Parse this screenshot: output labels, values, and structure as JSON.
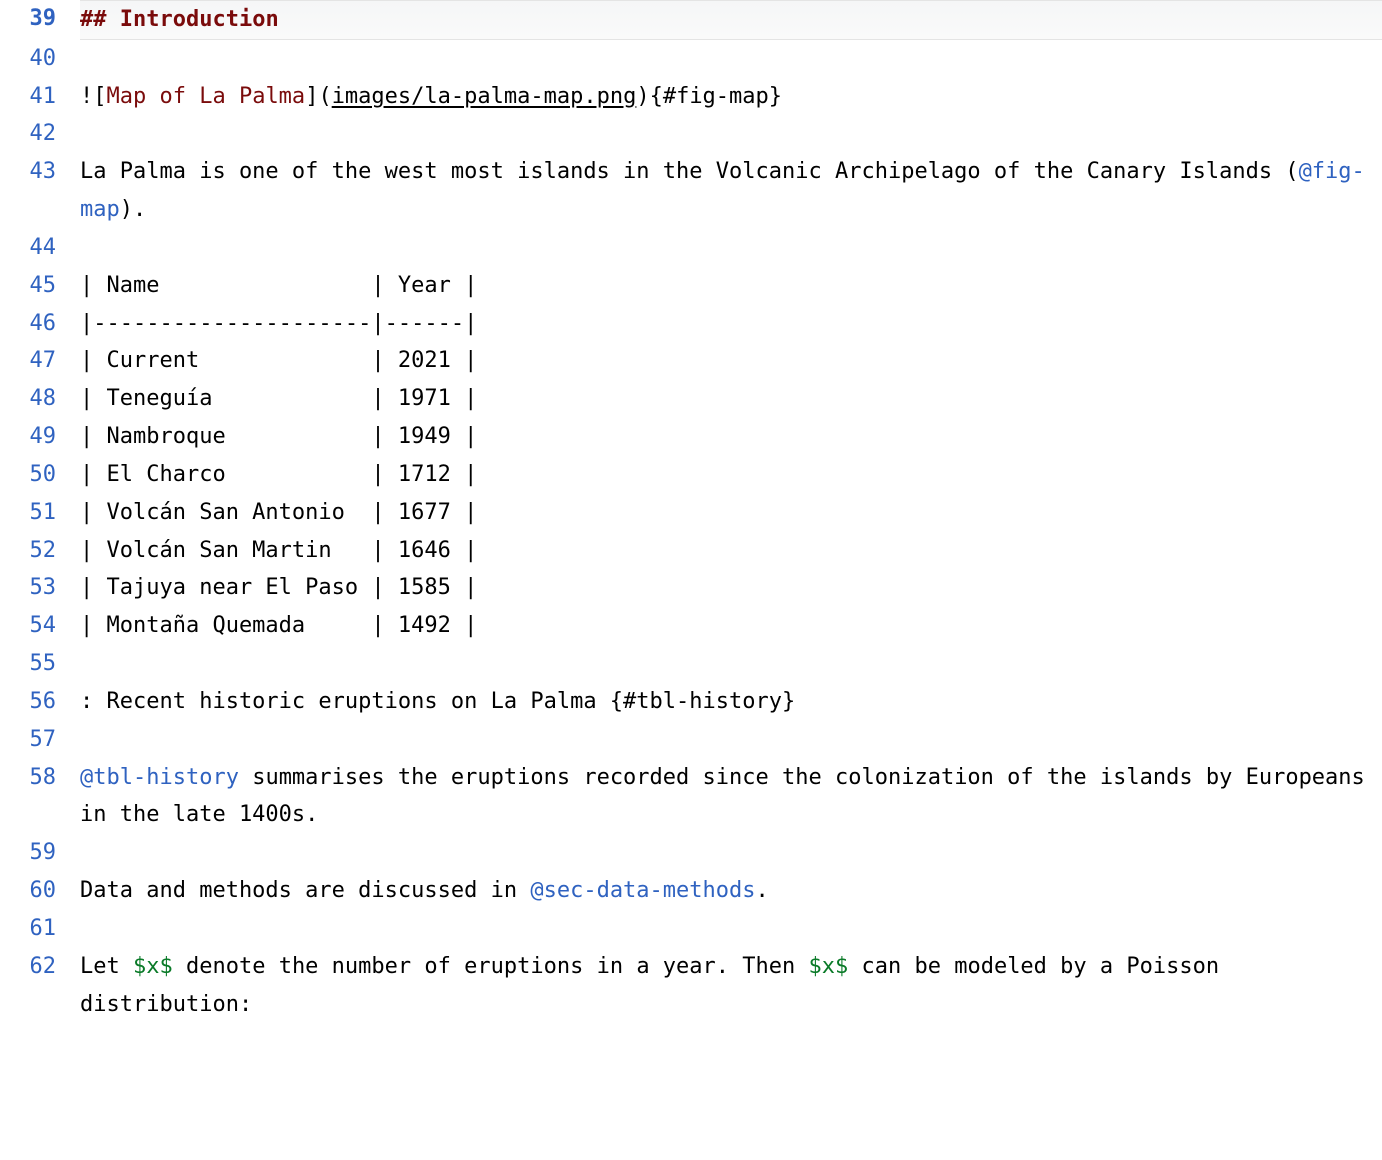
{
  "lines": [
    {
      "n": 39,
      "current": true,
      "segments": [
        {
          "cls": "hd-hash",
          "text": "## "
        },
        {
          "cls": "hd",
          "text": "Introduction"
        }
      ]
    },
    {
      "n": 40,
      "segments": []
    },
    {
      "n": 41,
      "segments": [
        {
          "cls": "plain",
          "text": "!"
        },
        {
          "cls": "bracket",
          "text": "["
        },
        {
          "cls": "alt",
          "text": "Map of La Palma"
        },
        {
          "cls": "bracket",
          "text": "]"
        },
        {
          "cls": "plain",
          "text": "("
        },
        {
          "cls": "link",
          "text": "images/la-palma-map.png"
        },
        {
          "cls": "plain",
          "text": ")"
        },
        {
          "cls": "meta",
          "text": "{#fig-map}"
        }
      ]
    },
    {
      "n": 42,
      "segments": []
    },
    {
      "n": 43,
      "segments": [
        {
          "cls": "plain",
          "text": "La Palma is one of the west most islands in the Volcanic Archipelago of the Canary Islands ("
        },
        {
          "cls": "ref",
          "text": "@fig-map"
        },
        {
          "cls": "plain",
          "text": ")."
        }
      ]
    },
    {
      "n": 44,
      "segments": []
    },
    {
      "n": 45,
      "segments": [
        {
          "cls": "plain",
          "text": "| Name                | Year |"
        }
      ]
    },
    {
      "n": 46,
      "segments": [
        {
          "cls": "plain",
          "text": "|---------------------|------|"
        }
      ]
    },
    {
      "n": 47,
      "segments": [
        {
          "cls": "plain",
          "text": "| Current             | 2021 |"
        }
      ]
    },
    {
      "n": 48,
      "segments": [
        {
          "cls": "plain",
          "text": "| Teneguía            | 1971 |"
        }
      ]
    },
    {
      "n": 49,
      "segments": [
        {
          "cls": "plain",
          "text": "| Nambroque           | 1949 |"
        }
      ]
    },
    {
      "n": 50,
      "segments": [
        {
          "cls": "plain",
          "text": "| El Charco           | 1712 |"
        }
      ]
    },
    {
      "n": 51,
      "segments": [
        {
          "cls": "plain",
          "text": "| Volcán San Antonio  | 1677 |"
        }
      ]
    },
    {
      "n": 52,
      "segments": [
        {
          "cls": "plain",
          "text": "| Volcán San Martin   | 1646 |"
        }
      ]
    },
    {
      "n": 53,
      "segments": [
        {
          "cls": "plain",
          "text": "| Tajuya near El Paso | 1585 |"
        }
      ]
    },
    {
      "n": 54,
      "segments": [
        {
          "cls": "plain",
          "text": "| Montaña Quemada     | 1492 |"
        }
      ]
    },
    {
      "n": 55,
      "segments": []
    },
    {
      "n": 56,
      "segments": [
        {
          "cls": "plain",
          "text": ": Recent historic eruptions on La Palma {#tbl-history}"
        }
      ]
    },
    {
      "n": 57,
      "segments": []
    },
    {
      "n": 58,
      "segments": [
        {
          "cls": "ref",
          "text": "@tbl-history"
        },
        {
          "cls": "plain",
          "text": " summarises the eruptions recorded since the colonization of the islands by Europeans in the late 1400s."
        }
      ]
    },
    {
      "n": 59,
      "segments": []
    },
    {
      "n": 60,
      "segments": [
        {
          "cls": "plain",
          "text": "Data and methods are discussed in "
        },
        {
          "cls": "ref",
          "text": "@sec-data-methods"
        },
        {
          "cls": "plain",
          "text": "."
        }
      ]
    },
    {
      "n": 61,
      "segments": []
    },
    {
      "n": 62,
      "segments": [
        {
          "cls": "plain",
          "text": "Let "
        },
        {
          "cls": "math",
          "text": "$x$"
        },
        {
          "cls": "plain",
          "text": " denote the number of eruptions in a year. Then "
        },
        {
          "cls": "math",
          "text": "$x$"
        },
        {
          "cls": "plain",
          "text": " can be modeled by a Poisson distribution:"
        }
      ]
    }
  ],
  "table_data": {
    "columns": [
      "Name",
      "Year"
    ],
    "rows": [
      [
        "Current",
        2021
      ],
      [
        "Teneguía",
        1971
      ],
      [
        "Nambroque",
        1949
      ],
      [
        "El Charco",
        1712
      ],
      [
        "Volcán San Antonio",
        1677
      ],
      [
        "Volcán San Martin",
        1646
      ],
      [
        "Tajuya near El Paso",
        1585
      ],
      [
        "Montaña Quemada",
        1492
      ]
    ],
    "caption": "Recent historic eruptions on La Palma",
    "id": "tbl-history"
  }
}
